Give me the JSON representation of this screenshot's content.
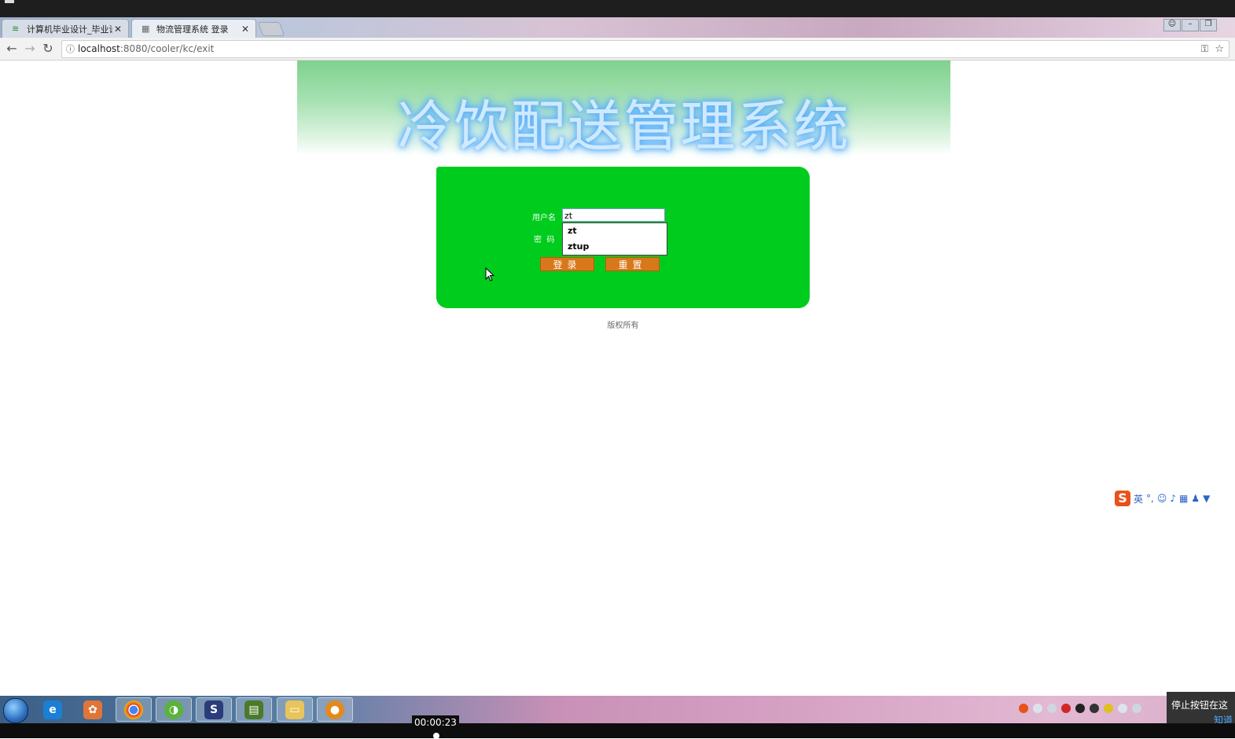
{
  "browser": {
    "tabs": [
      {
        "title": "计算机毕业设计_毕业设计",
        "active": false
      },
      {
        "title": "物流管理系统 登录",
        "active": true
      }
    ],
    "url_host": "localhost",
    "url_path": ":8080/cooler/kc/exit"
  },
  "page": {
    "banner_title": "冷饮配送管理系统",
    "form": {
      "username_label": "用户名",
      "password_label": "密  码",
      "username_value": "zt",
      "autocomplete": [
        "zt",
        "ztup"
      ],
      "login_button": "登录",
      "reset_button": "重置"
    },
    "copyright": "版权所有"
  },
  "ime": {
    "mode": "英"
  },
  "overlay": {
    "stop_tip": "停止按钮在这",
    "stop_tip_link": "知道",
    "timestamp": "00:00:23"
  },
  "colors": {
    "panel_green": "#00cc1e",
    "button_orange": "#d8781a",
    "banner_glow": "#5ab0ff"
  }
}
